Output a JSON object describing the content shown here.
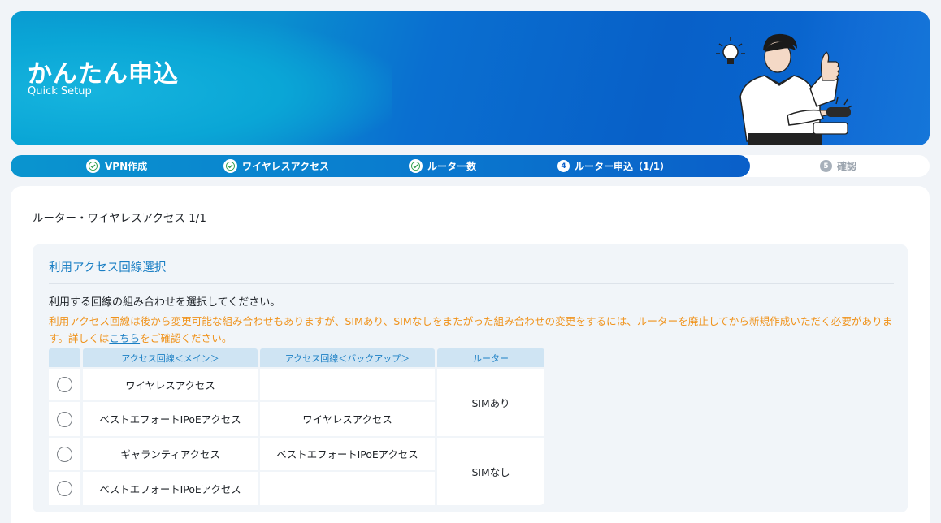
{
  "banner": {
    "title": "かんたん申込",
    "subtitle": "Quick Setup"
  },
  "stepper": {
    "steps": [
      {
        "label": "VPN作成",
        "state": "done"
      },
      {
        "label": "ワイヤレスアクセス",
        "state": "done"
      },
      {
        "label": "ルーター数",
        "state": "done"
      },
      {
        "number": "4",
        "label": "ルーター申込（1/1）",
        "state": "current"
      },
      {
        "number": "5",
        "label": "確認",
        "state": "pending"
      }
    ]
  },
  "main": {
    "title": "ルーター・ワイヤレスアクセス 1/1",
    "section": {
      "title": "利用アクセス回線選択",
      "instruction": "利用する回線の組み合わせを選択してください。",
      "warning_before": "利用アクセス回線は後から変更可能な組み合わせもありますが、SIMあり、SIMなしをまたがった組み合わせの変更をするには、ルーターを廃止してから新規作成いただく必要があります。詳しくは",
      "warning_link": "こちら",
      "warning_after": "をご確認ください。",
      "table": {
        "headers": [
          "アクセス回線＜メイン＞",
          "アクセス回線＜バックアップ＞",
          "ルーター"
        ],
        "rows": [
          {
            "main": "ワイヤレスアクセス",
            "backup": ""
          },
          {
            "main": "ベストエフォートIPoEアクセス",
            "backup": "ワイヤレスアクセス"
          },
          {
            "main": "ギャランティアクセス",
            "backup": "ベストエフォートIPoEアクセス"
          },
          {
            "main": "ベストエフォートIPoEアクセス",
            "backup": ""
          }
        ],
        "router_groups": [
          "SIMあり",
          "SIMなし"
        ]
      }
    }
  },
  "colors": {
    "accent": "#0a7dcf",
    "section_title": "#1b7fc4",
    "warning": "#f0931c",
    "table_header_bg": "#cfe4f3"
  }
}
